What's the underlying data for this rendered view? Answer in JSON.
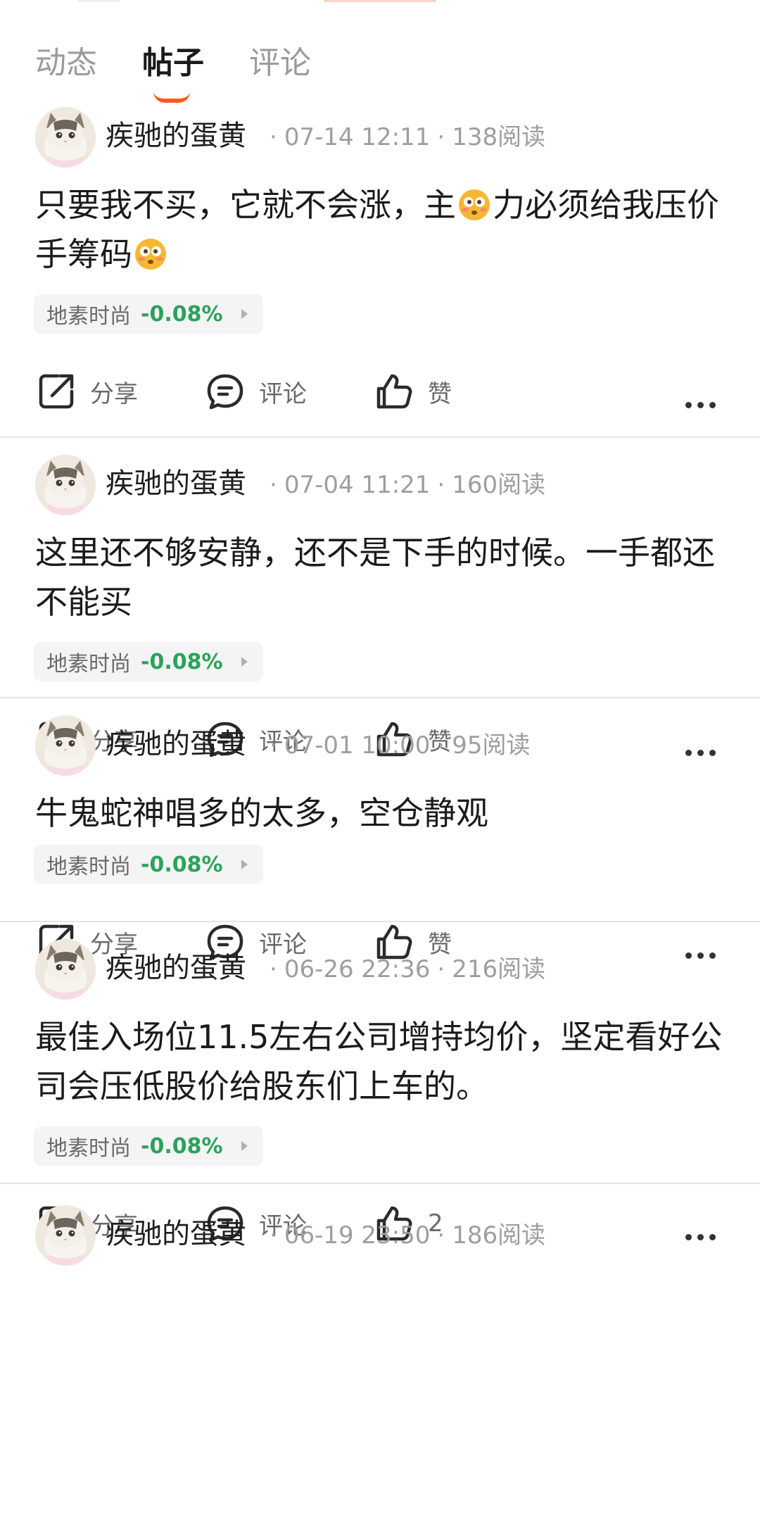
{
  "colors": {
    "accent": "#ff5a1f",
    "stock_down": "#2aa35a",
    "muted_text": "#9e9e9e"
  },
  "tabs": [
    {
      "label": "动态",
      "active": false
    },
    {
      "label": "帖子",
      "active": true
    },
    {
      "label": "评论",
      "active": false
    }
  ],
  "actions": {
    "share_label": "分享",
    "comment_label": "评论",
    "more_icon": "more-horizontal-icon"
  },
  "posts": [
    {
      "author": "疾驰的蛋黄",
      "time": "07-14 12:11",
      "reads": "138阅读",
      "content_parts": [
        "只要我不买，它就不会涨，主",
        "力必须给我压价手筹码"
      ],
      "emoji": "flushed-face-emoji",
      "stock": {
        "name": "地素时尚",
        "change": "-0.08%"
      },
      "like_label": "赞"
    },
    {
      "author": "疾驰的蛋黄",
      "time": "07-04 11:21",
      "reads": "160阅读",
      "content": "这里还不够安静，还不是下手的时候。一手都还不能买",
      "stock": {
        "name": "地素时尚",
        "change": "-0.08%"
      },
      "like_label": "赞"
    },
    {
      "author": "疾驰的蛋黄",
      "time": "07-01 10:00",
      "reads": "95阅读",
      "content": "牛鬼蛇神唱多的太多，空仓静观",
      "stock": {
        "name": "地素时尚",
        "change": "-0.08%"
      },
      "like_label": "赞"
    },
    {
      "author": "疾驰的蛋黄",
      "time": "06-26 22:36",
      "reads": "216阅读",
      "content": "最佳入场位11.5左右公司增持均价，坚定看好公司会压低股价给股东们上车的。",
      "stock": {
        "name": "地素时尚",
        "change": "-0.08%"
      },
      "like_label": "2"
    },
    {
      "author": "疾驰的蛋黄",
      "time": "06-19 23:50",
      "reads": "186阅读"
    }
  ]
}
